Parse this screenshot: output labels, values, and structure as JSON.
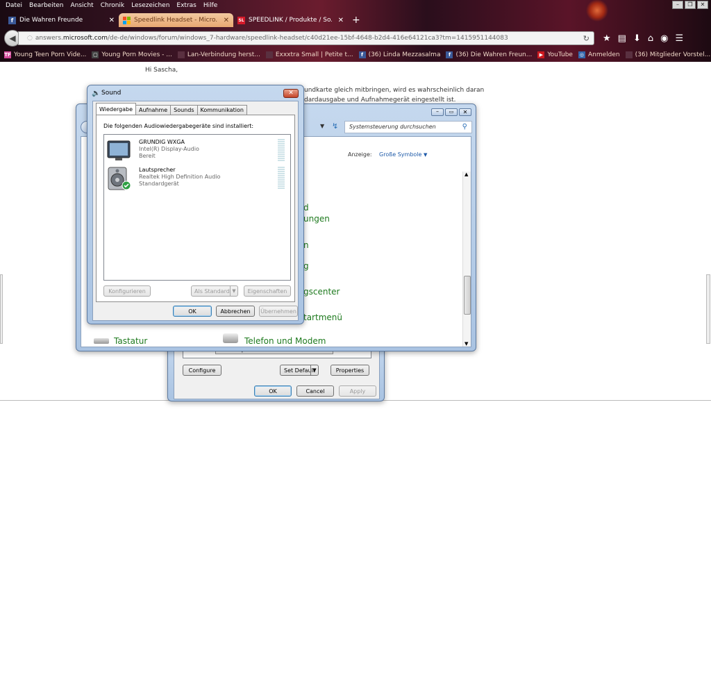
{
  "browser": {
    "menu": [
      "Datei",
      "Bearbeiten",
      "Ansicht",
      "Chronik",
      "Lesezeichen",
      "Extras",
      "Hilfe"
    ],
    "tabs": [
      {
        "label": "Die Wahren Freunde",
        "favicon": "f"
      },
      {
        "label": "Speedlink Headset - Micro...",
        "favicon": "ms"
      },
      {
        "label": "SPEEDLINK / Produkte / So...",
        "favicon": "SL"
      }
    ],
    "new_tab": "+",
    "url_prefix": "answers.",
    "url_domain": "microsoft.com",
    "url_rest": "/de-de/windows/forum/windows_7-hardware/speedlink-headset/c40d21ee-15bf-4648-b2d4-416e64121ca3?tm=1415951144083",
    "bookmarks": [
      {
        "label": "Young Teen Porn Vide...",
        "icon": "TF",
        "color": "#d24a9a"
      },
      {
        "label": "Young Porn Movies - ...",
        "icon": "▢",
        "color": "#444444"
      },
      {
        "label": "Lan-Verbindung herst...",
        "icon": "",
        "color": "#5a3040"
      },
      {
        "label": "Exxxtra Small | Petite t...",
        "icon": "",
        "color": "#5a3040"
      },
      {
        "label": "(36) Linda Mezzasalma",
        "icon": "f",
        "color": "#3b5998"
      },
      {
        "label": "(36) Die Wahren Freun...",
        "icon": "f",
        "color": "#3b5998"
      },
      {
        "label": "YouTube",
        "icon": "▶",
        "color": "#cc181e"
      },
      {
        "label": "Anmelden",
        "icon": "◎",
        "color": "#3366aa"
      },
      {
        "label": "(36) Mitglieder Vorstel...",
        "icon": "",
        "color": "#5a3040"
      }
    ]
  },
  "page": {
    "greeting": "Hi Sascha,",
    "line1": "undkarte gleich mitbringen, wird es wahrscheinlich daran",
    "line2": "dardausgabe und Aufnahmegerät eingestellt ist."
  },
  "control_panel": {
    "search_placeholder": "Systemsteuerung durchsuchen",
    "view_label": "Anzeige:",
    "view_value": "Große Symbole",
    "items": [
      "d",
      "ungen",
      "n",
      "g",
      "gscenter",
      "tartmenü",
      "Tastatur",
      "Telefon und Modem"
    ]
  },
  "audio_window": {
    "partial_item": "Properties",
    "configure": "Configure",
    "set_default": "Set Default",
    "properties": "Properties",
    "ok": "OK",
    "cancel": "Cancel",
    "apply": "Apply"
  },
  "sound_dialog": {
    "title": "Sound",
    "tabs": [
      "Wiedergabe",
      "Aufnahme",
      "Sounds",
      "Kommunikation"
    ],
    "intro": "Die folgenden Audiowiedergabegeräte sind installiert:",
    "devices": [
      {
        "name": "GRUNDIG WXGA",
        "driver": "Intel(R) Display-Audio",
        "status": "Bereit"
      },
      {
        "name": "Lautsprecher",
        "driver": "Realtek High Definition Audio",
        "status": "Standardgerät"
      }
    ],
    "configure": "Konfigurieren",
    "set_default": "Als Standard",
    "properties": "Eigenschaften",
    "ok": "OK",
    "cancel": "Abbrechen",
    "apply": "Übernehmen"
  }
}
